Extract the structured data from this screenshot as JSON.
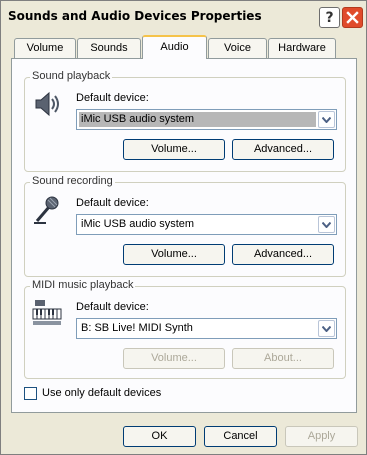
{
  "window": {
    "title": "Sounds and Audio Devices Properties"
  },
  "titlebar": {
    "help_label": "?",
    "close_icon": "close-icon"
  },
  "tabs": [
    {
      "label": "Volume"
    },
    {
      "label": "Sounds"
    },
    {
      "label": "Audio"
    },
    {
      "label": "Voice"
    },
    {
      "label": "Hardware"
    }
  ],
  "active_tab": "Audio",
  "playback": {
    "group_label": "Sound playback",
    "icon": "speaker-icon",
    "device_label": "Default device:",
    "device_value": "iMic USB audio system",
    "volume_label": "Volume...",
    "advanced_label": "Advanced..."
  },
  "recording": {
    "group_label": "Sound recording",
    "icon": "microphone-icon",
    "device_label": "Default device:",
    "device_value": "iMic USB audio system",
    "volume_label": "Volume...",
    "advanced_label": "Advanced..."
  },
  "midi": {
    "group_label": "MIDI music playback",
    "icon": "midi-keyboard-icon",
    "device_label": "Default device:",
    "device_value": "B: SB Live! MIDI Synth",
    "volume_label": "Volume...",
    "about_label": "About..."
  },
  "default_only": {
    "label": "Use only default devices",
    "checked": false
  },
  "footer": {
    "ok_label": "OK",
    "cancel_label": "Cancel",
    "apply_label": "Apply"
  },
  "colors": {
    "accent_tab": "#f5c34a",
    "close": "#e04b2b",
    "button_border": "#003c74"
  }
}
